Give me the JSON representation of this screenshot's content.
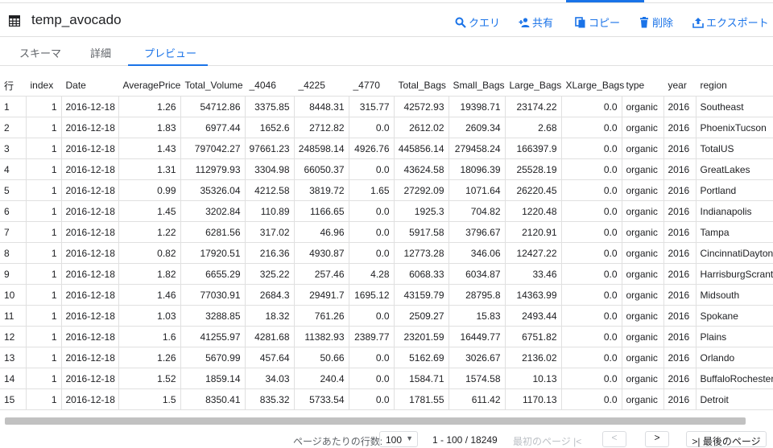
{
  "header": {
    "title": "temp_avocado",
    "actions": {
      "query": "クエリ",
      "share": "共有",
      "copy": "コピー",
      "delete": "削除",
      "export": "エクスポート"
    },
    "accent": "#1a73e8"
  },
  "tabs": [
    "スキーマ",
    "詳細",
    "プレビュー"
  ],
  "table": {
    "columns": [
      "行",
      "index",
      "Date",
      "AveragePrice",
      "Total_Volume",
      "_4046",
      "_4225",
      "_4770",
      "Total_Bags",
      "Small_Bags",
      "Large_Bags",
      "XLarge_Bags",
      "type",
      "year",
      "region"
    ],
    "rows": [
      [
        "1",
        "1",
        "2016-12-18",
        "1.26",
        "54712.86",
        "3375.85",
        "8448.31",
        "315.77",
        "42572.93",
        "19398.71",
        "23174.22",
        "0.0",
        "organic",
        "2016",
        "Southeast"
      ],
      [
        "2",
        "1",
        "2016-12-18",
        "1.83",
        "6977.44",
        "1652.6",
        "2712.82",
        "0.0",
        "2612.02",
        "2609.34",
        "2.68",
        "0.0",
        "organic",
        "2016",
        "PhoenixTucson"
      ],
      [
        "3",
        "1",
        "2016-12-18",
        "1.43",
        "797042.27",
        "97661.23",
        "248598.14",
        "4926.76",
        "445856.14",
        "279458.24",
        "166397.9",
        "0.0",
        "organic",
        "2016",
        "TotalUS"
      ],
      [
        "4",
        "1",
        "2016-12-18",
        "1.31",
        "112979.93",
        "3304.98",
        "66050.37",
        "0.0",
        "43624.58",
        "18096.39",
        "25528.19",
        "0.0",
        "organic",
        "2016",
        "GreatLakes"
      ],
      [
        "5",
        "1",
        "2016-12-18",
        "0.99",
        "35326.04",
        "4212.58",
        "3819.72",
        "1.65",
        "27292.09",
        "1071.64",
        "26220.45",
        "0.0",
        "organic",
        "2016",
        "Portland"
      ],
      [
        "6",
        "1",
        "2016-12-18",
        "1.45",
        "3202.84",
        "110.89",
        "1166.65",
        "0.0",
        "1925.3",
        "704.82",
        "1220.48",
        "0.0",
        "organic",
        "2016",
        "Indianapolis"
      ],
      [
        "7",
        "1",
        "2016-12-18",
        "1.22",
        "6281.56",
        "317.02",
        "46.96",
        "0.0",
        "5917.58",
        "3796.67",
        "2120.91",
        "0.0",
        "organic",
        "2016",
        "Tampa"
      ],
      [
        "8",
        "1",
        "2016-12-18",
        "0.82",
        "17920.51",
        "216.36",
        "4930.87",
        "0.0",
        "12773.28",
        "346.06",
        "12427.22",
        "0.0",
        "organic",
        "2016",
        "CincinnatiDayton"
      ],
      [
        "9",
        "1",
        "2016-12-18",
        "1.82",
        "6655.29",
        "325.22",
        "257.46",
        "4.28",
        "6068.33",
        "6034.87",
        "33.46",
        "0.0",
        "organic",
        "2016",
        "HarrisburgScranton"
      ],
      [
        "10",
        "1",
        "2016-12-18",
        "1.46",
        "77030.91",
        "2684.3",
        "29491.7",
        "1695.12",
        "43159.79",
        "28795.8",
        "14363.99",
        "0.0",
        "organic",
        "2016",
        "Midsouth"
      ],
      [
        "11",
        "1",
        "2016-12-18",
        "1.03",
        "3288.85",
        "18.32",
        "761.26",
        "0.0",
        "2509.27",
        "15.83",
        "2493.44",
        "0.0",
        "organic",
        "2016",
        "Spokane"
      ],
      [
        "12",
        "1",
        "2016-12-18",
        "1.6",
        "41255.97",
        "4281.68",
        "11382.93",
        "2389.77",
        "23201.59",
        "16449.77",
        "6751.82",
        "0.0",
        "organic",
        "2016",
        "Plains"
      ],
      [
        "13",
        "1",
        "2016-12-18",
        "1.26",
        "5670.99",
        "457.64",
        "50.66",
        "0.0",
        "5162.69",
        "3026.67",
        "2136.02",
        "0.0",
        "organic",
        "2016",
        "Orlando"
      ],
      [
        "14",
        "1",
        "2016-12-18",
        "1.52",
        "1859.14",
        "34.03",
        "240.4",
        "0.0",
        "1584.71",
        "1574.58",
        "10.13",
        "0.0",
        "organic",
        "2016",
        "BuffaloRochester"
      ],
      [
        "15",
        "1",
        "2016-12-18",
        "1.5",
        "8350.41",
        "835.32",
        "5733.54",
        "0.0",
        "1781.55",
        "611.42",
        "1170.13",
        "0.0",
        "organic",
        "2016",
        "Detroit"
      ]
    ]
  },
  "footer": {
    "rows_per_page_label": "ページあたりの行数:",
    "rows_per_page_value": "100",
    "range": "1 - 100 / 18249",
    "first_page": "最初のページ",
    "last_page": "最後のページ"
  }
}
